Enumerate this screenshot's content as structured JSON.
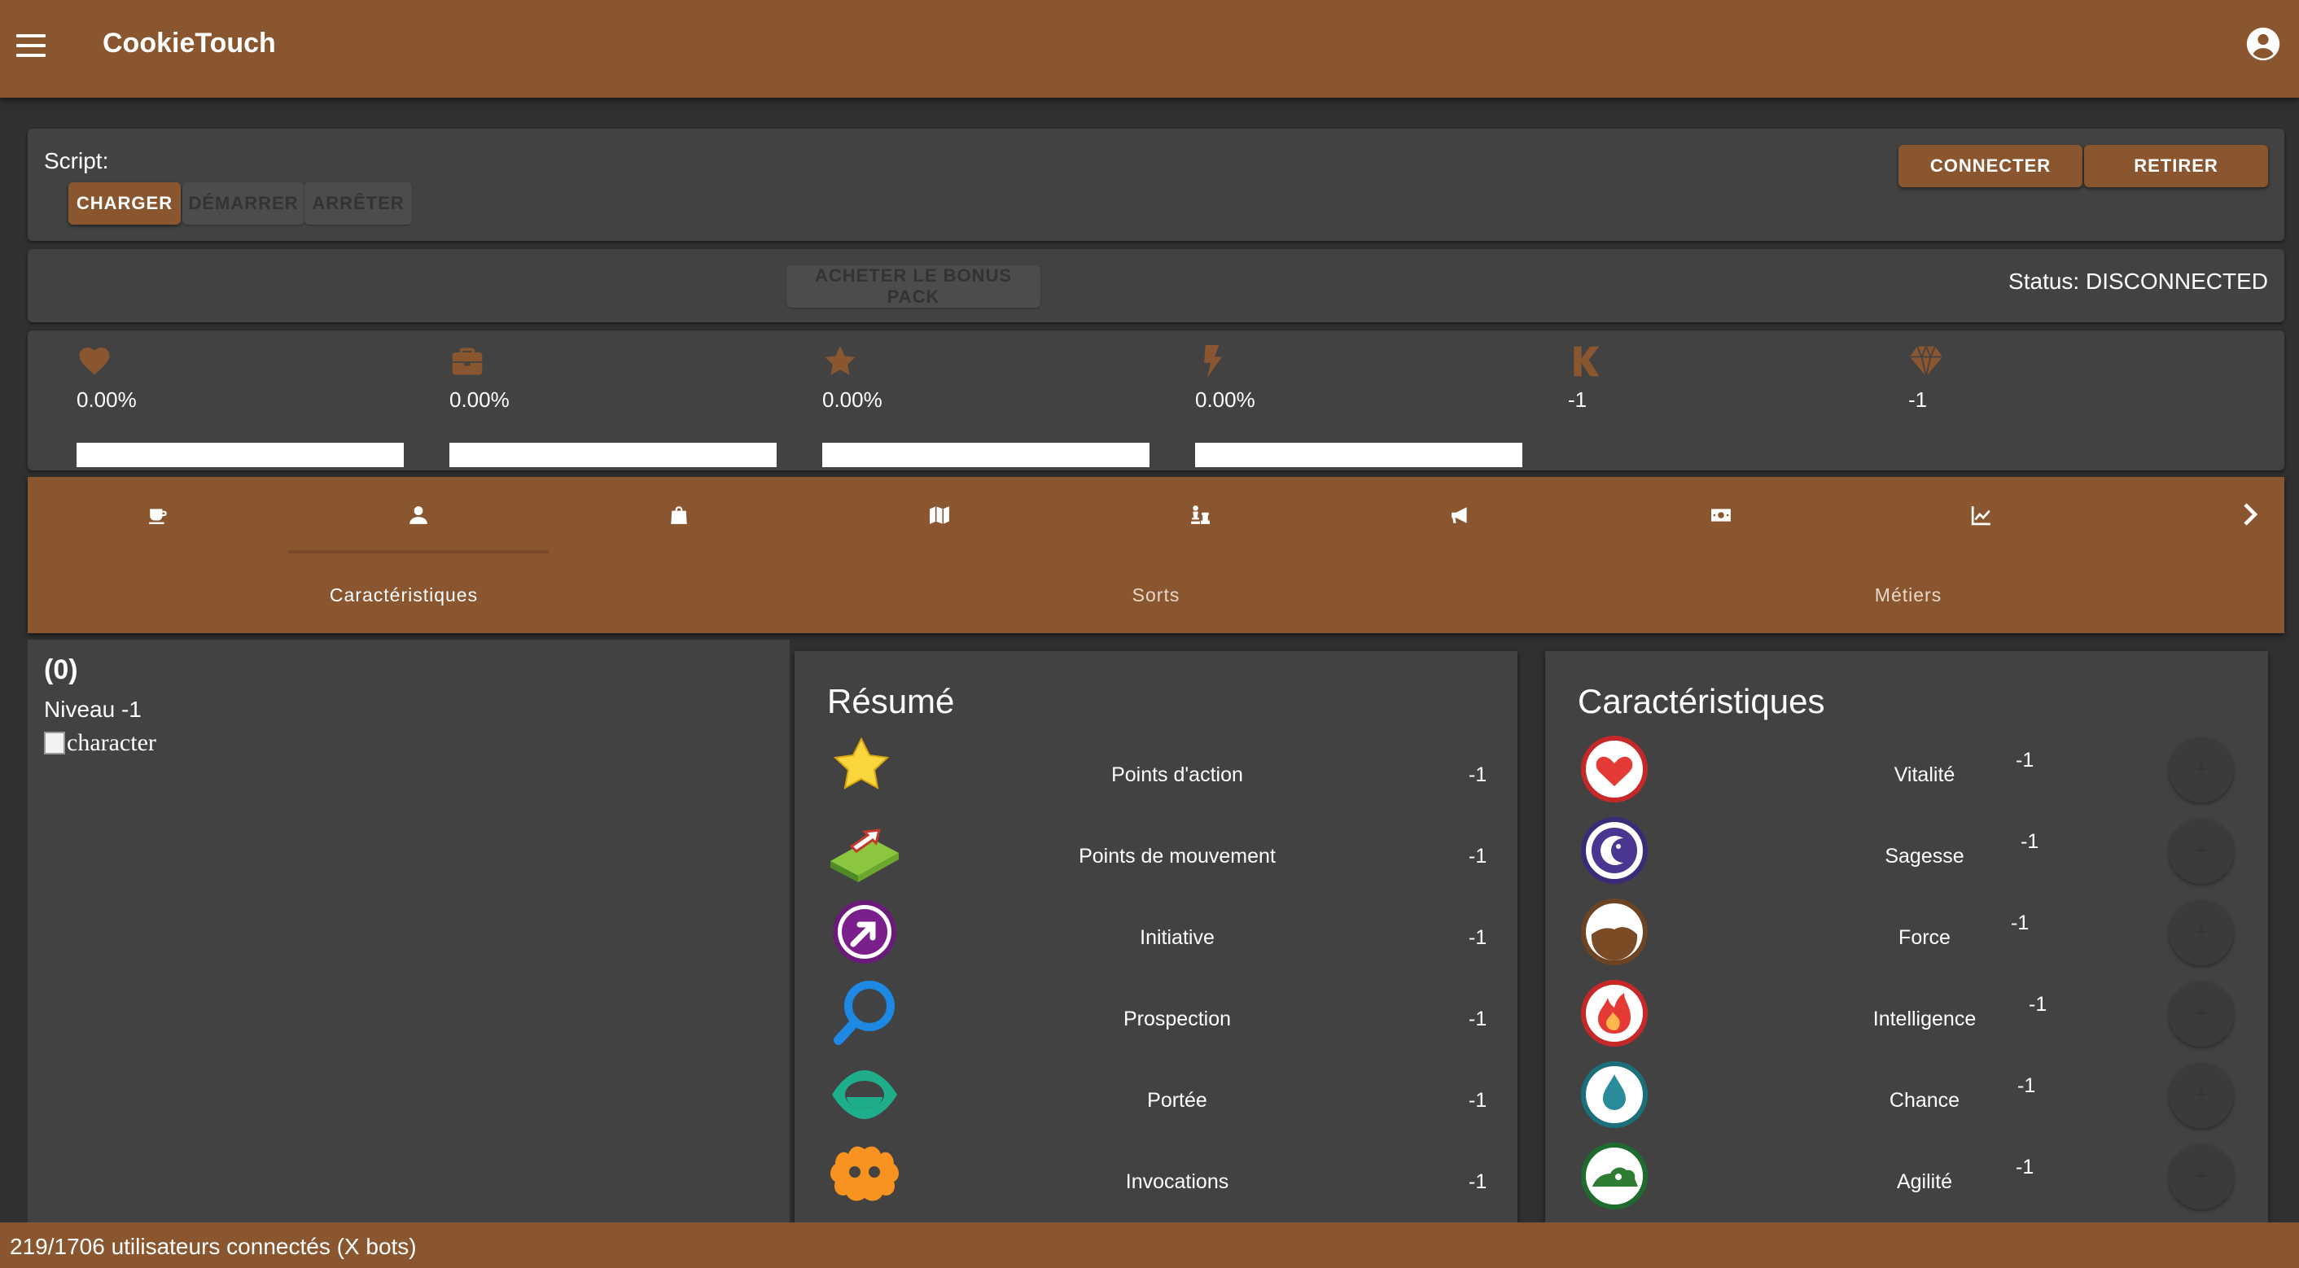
{
  "app": {
    "title": "CookieTouch"
  },
  "script": {
    "label": "Script:",
    "load_label": "Charger",
    "start_label": "Démarrer",
    "stop_label": "Arrêter",
    "connect_label": "Connecter",
    "remove_label": "Retirer"
  },
  "status": {
    "bonus_pack_label": "Acheter le bonus pack",
    "text": "Status: DISCONNECTED"
  },
  "stats": [
    {
      "icon": "heart-icon",
      "value": "0.00%",
      "progress": 0
    },
    {
      "icon": "briefcase-icon",
      "value": "0.00%",
      "progress": 0
    },
    {
      "icon": "star-icon",
      "value": "0.00%",
      "progress": 0
    },
    {
      "icon": "bolt-icon",
      "value": "0.00%",
      "progress": 0
    },
    {
      "icon": "kamas-icon",
      "value": "-1"
    },
    {
      "icon": "gem-icon",
      "value": "-1"
    }
  ],
  "nav_tabs": [
    {
      "icon": "coffee-icon"
    },
    {
      "icon": "user-icon",
      "active": true
    },
    {
      "icon": "shopping-bag-icon"
    },
    {
      "icon": "map-icon"
    },
    {
      "icon": "chess-icon"
    },
    {
      "icon": "megaphone-icon"
    },
    {
      "icon": "money-icon"
    },
    {
      "icon": "chart-icon"
    }
  ],
  "sub_tabs": [
    "Caractéristiques",
    "Sorts",
    "Métiers"
  ],
  "character": {
    "count": "(0)",
    "level": "Niveau -1",
    "image_alt": "character"
  },
  "resume": {
    "title": "Résumé",
    "rows": [
      {
        "icon": "star-icon",
        "label": "Points d'action",
        "value": "-1"
      },
      {
        "icon": "movement-icon",
        "label": "Points de mouvement",
        "value": "-1"
      },
      {
        "icon": "initiative-icon",
        "label": "Initiative",
        "value": "-1"
      },
      {
        "icon": "magnifier-icon",
        "label": "Prospection",
        "value": "-1"
      },
      {
        "icon": "eye-icon",
        "label": "Portée",
        "value": "-1"
      },
      {
        "icon": "summon-icon",
        "label": "Invocations",
        "value": "-1"
      }
    ]
  },
  "characteristics": {
    "title": "Caractéristiques",
    "plus_label": "+",
    "rows": [
      {
        "icon": "vitality-icon",
        "label": "Vitalité",
        "value": "-1"
      },
      {
        "icon": "wisdom-icon",
        "label": "Sagesse",
        "value": "-1"
      },
      {
        "icon": "strength-icon",
        "label": "Force",
        "value": "-1"
      },
      {
        "icon": "intelligence-icon",
        "label": "Intelligence",
        "value": "-1"
      },
      {
        "icon": "chance-icon",
        "label": "Chance",
        "value": "-1"
      },
      {
        "icon": "agility-icon",
        "label": "Agilité",
        "value": "-1"
      }
    ]
  },
  "footer": {
    "text": "219/1706 utilisateurs connectés (X bots)"
  },
  "colors": {
    "brand": "#8a5630",
    "background": "#303030",
    "card": "#424242"
  }
}
